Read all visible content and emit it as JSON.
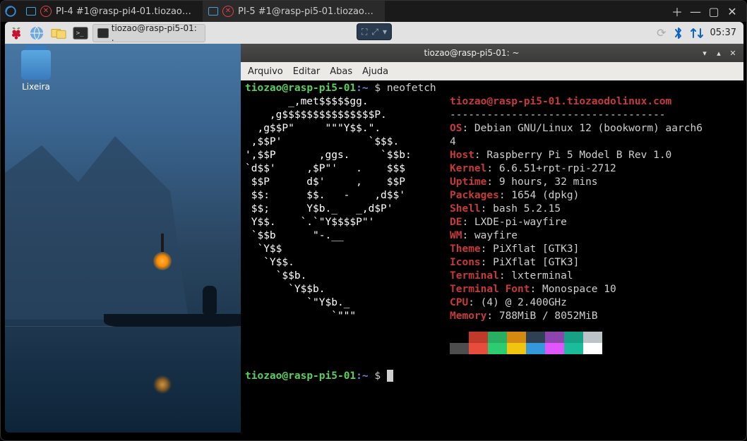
{
  "outer_tabs": [
    {
      "label": "PI-4 #1@rasp-pi4-01.tiozaodol…",
      "active": false
    },
    {
      "label": "PI-5 #1@rasp-pi5-01.tiozaodol…",
      "active": true
    }
  ],
  "taskbar": {
    "task_entry_label": "tiozao@rasp-pi5-01: .",
    "clock": "05:37"
  },
  "resize_widget": {
    "glyph1": "⛶",
    "glyph2": "⤢",
    "glyph3": "▾"
  },
  "desktop": {
    "trash_label": "Lixeira"
  },
  "terminal": {
    "title": "tiozao@rasp-pi5-01: ~",
    "menu": {
      "file": "Arquivo",
      "edit": "Editar",
      "tabs": "Abas",
      "help": "Ajuda"
    },
    "prompt": {
      "user": "tiozao",
      "host": "rasp-pi5-01",
      "path": "~",
      "symbol": "$"
    },
    "command": "neofetch",
    "ascii": [
      "       _,met$$$$$gg.",
      "    ,g$$$$$$$$$$$$$$$P.",
      "  ,g$$P\"     \"\"\"Y$$.\".",
      " ,$$P'              `$$$.",
      "',$$P       ,ggs.     `$$b:",
      "`d$$'     ,$P\"'   .    $$$",
      " $$P      d$'     ,    $$P",
      " $$:      $$.   -    ,d$$'",
      " $$;      Y$b._   _,d$P'",
      " Y$$.    `.`\"Y$$$$P\"'",
      " `$$b      \"-.__",
      "  `Y$$",
      "   `Y$$.",
      "     `$$b.",
      "       `Y$$b.",
      "          `\"Y$b._",
      "              `\"\"\""
    ],
    "title_line": "tiozao@rasp-pi5-01.tiozaodolinux.com",
    "dash_line": "-----------------------------------",
    "info": [
      {
        "key": "OS",
        "val": ": Debian GNU/Linux 12 (bookworm) aarch6"
      },
      {
        "key": "",
        "val": "4"
      },
      {
        "key": "Host",
        "val": ": Raspberry Pi 5 Model B Rev 1.0"
      },
      {
        "key": "Kernel",
        "val": ": 6.6.51+rpt-rpi-2712"
      },
      {
        "key": "Uptime",
        "val": ": 9 hours, 32 mins"
      },
      {
        "key": "Packages",
        "val": ": 1654 (dpkg)"
      },
      {
        "key": "Shell",
        "val": ": bash 5.2.15"
      },
      {
        "key": "DE",
        "val": ": LXDE-pi-wayfire"
      },
      {
        "key": "WM",
        "val": ": wayfire"
      },
      {
        "key": "Theme",
        "val": ": PiXflat [GTK3]"
      },
      {
        "key": "Icons",
        "val": ": PiXflat [GTK3]"
      },
      {
        "key": "Terminal",
        "val": ": lxterminal"
      },
      {
        "key": "Terminal Font",
        "val": ": Monospace 10"
      },
      {
        "key": "CPU",
        "val": ": (4) @ 2.400GHz"
      },
      {
        "key": "Memory",
        "val": ": 788MiB / 8052MiB"
      }
    ],
    "color_row1": [
      "#000000",
      "#c0392b",
      "#27ae60",
      "#d68910",
      "#2e4053",
      "#8e44ad",
      "#16a085",
      "#bdc3c7"
    ],
    "color_row2": [
      "#4d4d4d",
      "#e74c3c",
      "#2ecc71",
      "#f1c40f",
      "#3498db",
      "#e056fd",
      "#1abc9c",
      "#ffffff"
    ]
  }
}
